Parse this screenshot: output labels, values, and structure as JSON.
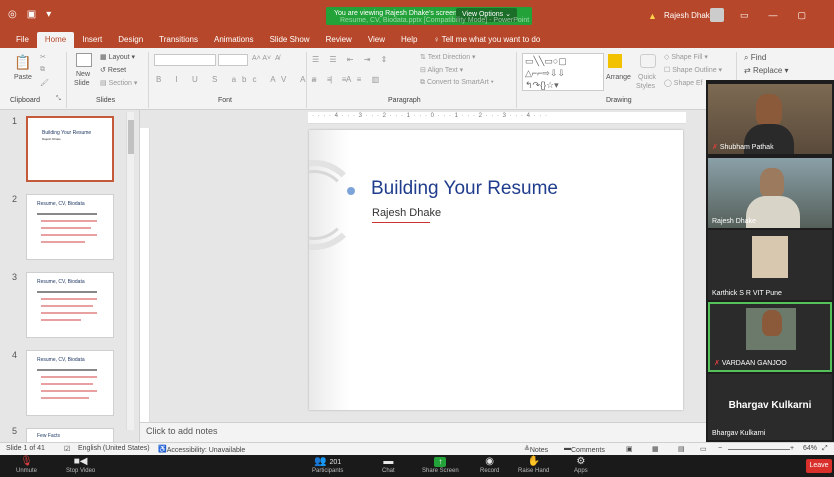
{
  "titlebar": {
    "banner_text": "You are viewing Rajesh Dhake's screen",
    "view_options": "View Options",
    "doc_title": "Resume, CV, Biodata.pptx [Compatibility Mode] - PowerPoint",
    "user_name": "Rajesh Dhake"
  },
  "tabs": [
    "File",
    "Home",
    "Insert",
    "Design",
    "Transitions",
    "Animations",
    "Slide Show",
    "Review",
    "View",
    "Help"
  ],
  "tell_me": "Tell me what you want to do",
  "ribbon": {
    "clipboard": {
      "label": "Clipboard",
      "paste": "Paste"
    },
    "slides": {
      "label": "Slides",
      "new_slide": "New",
      "new_slide2": "Slide",
      "layout": "Layout",
      "reset": "Reset",
      "section": "Section"
    },
    "font": {
      "label": "Font"
    },
    "paragraph": {
      "label": "Paragraph",
      "text_direction": "Text Direction",
      "align_text": "Align Text",
      "smartart": "Convert to SmartArt"
    },
    "drawing": {
      "label": "Drawing",
      "arrange": "Arrange",
      "quick_styles": "Quick",
      "quick_styles2": "Styles",
      "shape_fill": "Shape Fill",
      "shape_outline": "Shape Outline",
      "shape_effects": "Shape Ef"
    },
    "editing": {
      "find": "Find",
      "replace": "Replace"
    }
  },
  "thumbnails": [
    {
      "num": "1",
      "title": "Building Your Resume",
      "sub": "Rajesh Dhake"
    },
    {
      "num": "2",
      "title": "Resume, CV, Biodata"
    },
    {
      "num": "3",
      "title": "Resume, CV, Biodata"
    },
    {
      "num": "4",
      "title": "Resume, CV, Biodata"
    },
    {
      "num": "5",
      "title": "Few Facts"
    }
  ],
  "ruler_marks": "· · · · 4 · · · 3 · · · 2 · · · 1 · · · 0 · · · 1 · · · 2 · · · 3 · · · 4 · · ·",
  "slide": {
    "title": "Building Your Resume",
    "subtitle": "Rajesh Dhake"
  },
  "notes_placeholder": "Click to add notes",
  "status": {
    "slide_of": "Slide 1 of 41",
    "language": "English (United States)",
    "accessibility": "Accessibility: Unavailable",
    "notes": "Notes",
    "comments": "Comments",
    "zoom": "64%"
  },
  "meeting": {
    "unmute": "Unmute",
    "stop_video": "Stop Video",
    "participants": "Participants",
    "participants_count": "201",
    "chat": "Chat",
    "share_screen": "Share Screen",
    "record": "Record",
    "raise_hand": "Raise Hand",
    "apps": "Apps",
    "leave": "Leave"
  },
  "participants": [
    {
      "name": "Shubham Pathak"
    },
    {
      "name": "Rajesh Dhake"
    },
    {
      "name": "Karthick S R VIT Pune"
    },
    {
      "name": "VARDAAN GANJOO"
    },
    {
      "name": "Bhargav Kulkarni",
      "display": "Bhargav Kulkarni"
    }
  ],
  "colors": {
    "ppt_red": "#b7472a",
    "zoom_green": "#23a23a",
    "leave_red": "#d9302c",
    "title_blue": "#1f3d8c"
  }
}
